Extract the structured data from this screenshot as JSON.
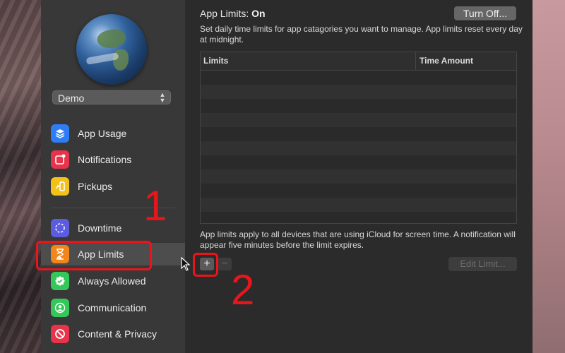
{
  "sidebar": {
    "user": "Demo",
    "items": [
      {
        "label": "App Usage",
        "icon": "stack-icon",
        "color": "#2f7df6"
      },
      {
        "label": "Notifications",
        "icon": "notification-badge-icon",
        "color": "#e8344a"
      },
      {
        "label": "Pickups",
        "icon": "pickup-phone-icon",
        "color": "#f2c21b"
      },
      {
        "label": "Downtime",
        "icon": "downtime-moon-icon",
        "color": "#5b5ce0"
      },
      {
        "label": "App Limits",
        "icon": "hourglass-icon",
        "color": "#f2851c"
      },
      {
        "label": "Always Allowed",
        "icon": "checkmark-badge-icon",
        "color": "#34c759"
      },
      {
        "label": "Communication",
        "icon": "person-icon",
        "color": "#34c759"
      },
      {
        "label": "Content & Privacy",
        "icon": "no-entry-icon",
        "color": "#e8344a"
      }
    ]
  },
  "main": {
    "title_prefix": "App Limits:",
    "title_status": "On",
    "turn_off_label": "Turn Off...",
    "description": "Set daily time limits for app catagories you want to manage. App limits reset every day at midnight.",
    "table": {
      "col_limits": "Limits",
      "col_time": "Time Amount",
      "rows": []
    },
    "footer_text": "App limits apply to all devices that are using iCloud for screen time. A notification will appear five minutes before the limit expires.",
    "add_label": "+",
    "remove_label": "−",
    "edit_label": "Edit Limit..."
  },
  "annotations": {
    "step1": "1",
    "step2": "2",
    "color": "#e8161a"
  }
}
